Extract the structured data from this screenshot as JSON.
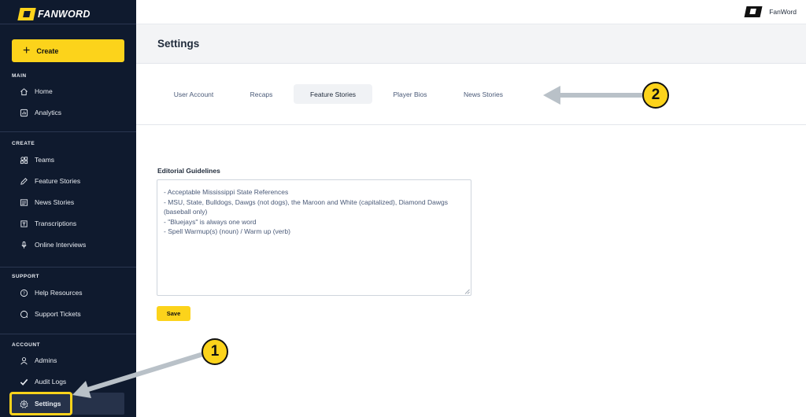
{
  "sidebar": {
    "logo_text": "FANWORD",
    "create_label": "Create",
    "sections": {
      "main": "MAIN",
      "create": "CREATE",
      "support": "SUPPORT",
      "account": "ACCOUNT"
    },
    "items": {
      "home": "Home",
      "analytics": "Analytics",
      "teams": "Teams",
      "feature_stories": "Feature Stories",
      "news_stories": "News Stories",
      "transcriptions": "Transcriptions",
      "online_interviews": "Online Interviews",
      "help_resources": "Help Resources",
      "support_tickets": "Support Tickets",
      "admins": "Admins",
      "audit_logs": "Audit Logs",
      "settings": "Settings"
    }
  },
  "topbar": {
    "brand": "FanWord"
  },
  "page": {
    "title": "Settings"
  },
  "tabs": [
    {
      "label": "User Account",
      "active": false
    },
    {
      "label": "Recaps",
      "active": false
    },
    {
      "label": "Feature Stories",
      "active": true
    },
    {
      "label": "Player Bios",
      "active": false
    },
    {
      "label": "News Stories",
      "active": false
    }
  ],
  "editorial": {
    "label": "Editorial Guidelines",
    "text": "- Acceptable Mississippi State References\n- MSU, State, Bulldogs, Dawgs (not dogs), the Maroon and White (capitalized), Diamond Dawgs (baseball only)\n- \"Bluejays\" is always one word\n- Spell Warmup(s) (noun) / Warm up (verb)",
    "save_label": "Save"
  },
  "callouts": {
    "one": "1",
    "two": "2"
  },
  "colors": {
    "accent": "#fcd31b",
    "sidebar_bg": "#0f1a2e",
    "arrow": "#b9c1c8"
  }
}
